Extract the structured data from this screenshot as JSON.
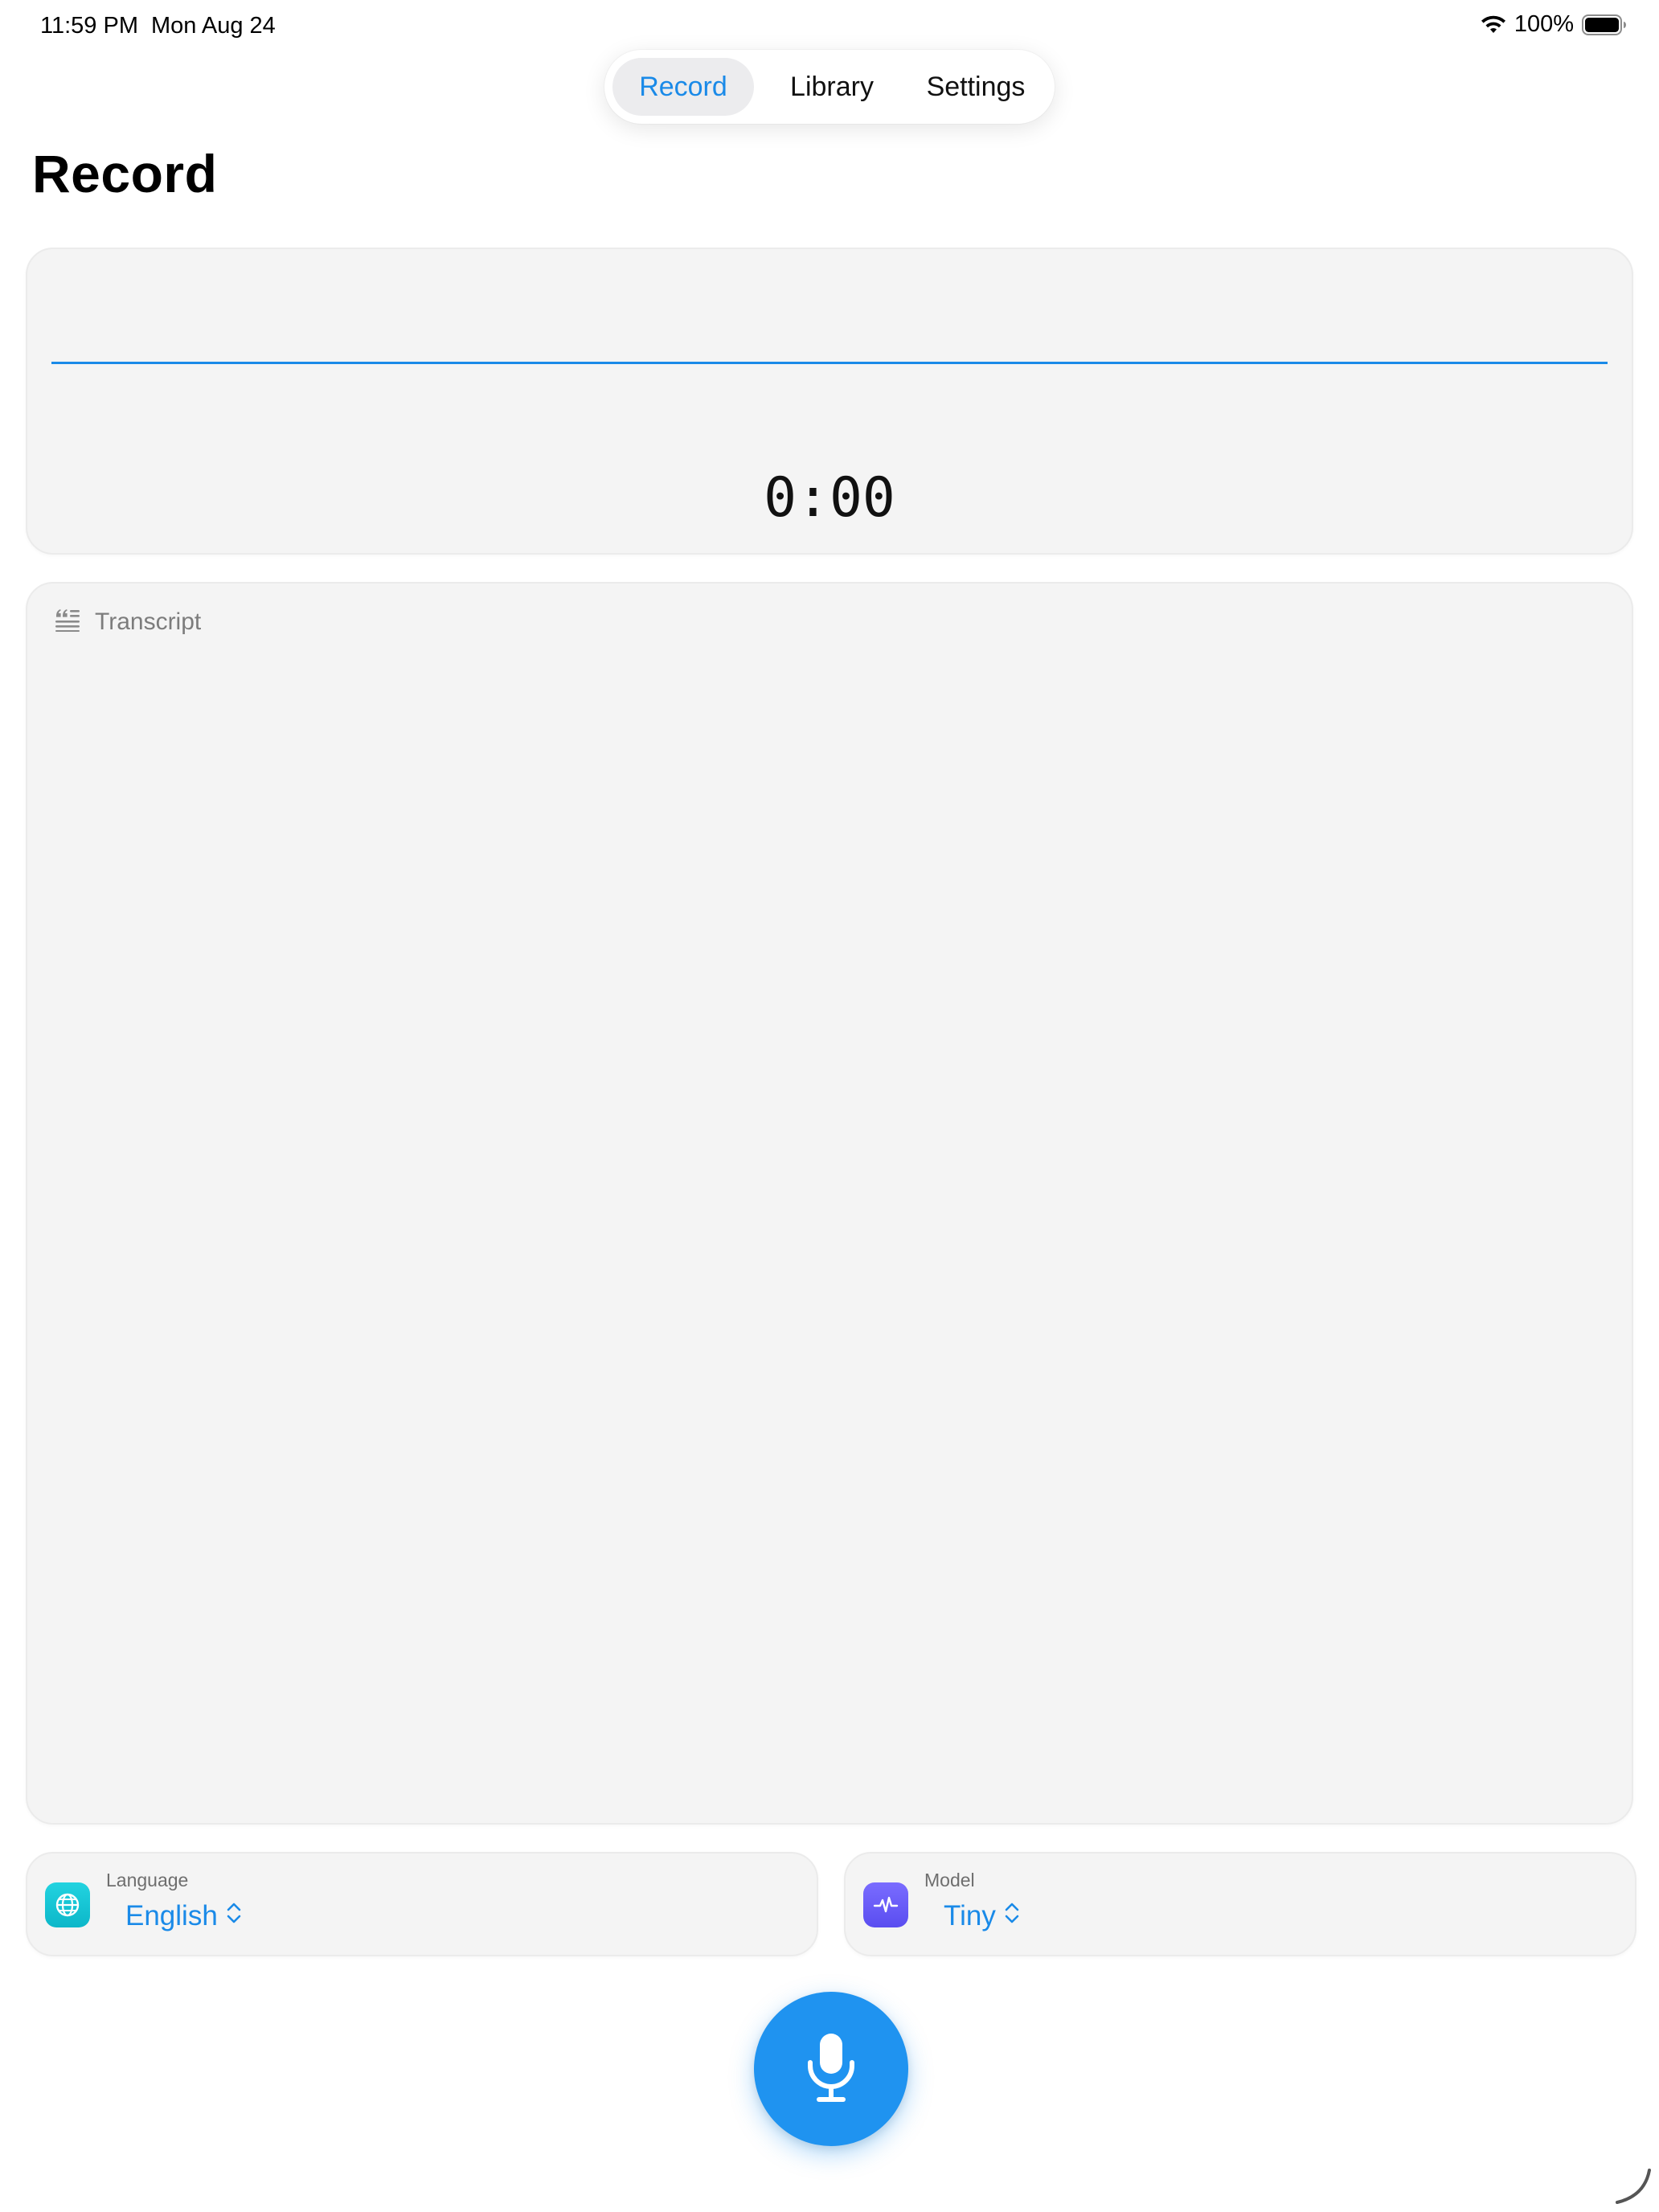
{
  "status_bar": {
    "time": "11:59 PM",
    "date": "Mon Aug 24",
    "battery": "100%"
  },
  "tabs": [
    {
      "label": "Record",
      "active": true
    },
    {
      "label": "Library",
      "active": false
    },
    {
      "label": "Settings",
      "active": false
    }
  ],
  "page": {
    "title": "Record"
  },
  "recorder": {
    "timer": "0:00",
    "waveform_color": "#1a8ae8"
  },
  "transcript": {
    "label": "Transcript",
    "icon": "quote-text-icon"
  },
  "language_picker": {
    "caption": "Language",
    "value": "English",
    "icon": "globe-icon"
  },
  "model_picker": {
    "caption": "Model",
    "value": "Tiny",
    "icon": "waveform-icon"
  },
  "mic_button": {
    "icon": "microphone-icon",
    "color": "#1f93f0"
  },
  "colors": {
    "accent": "#1a8ae8",
    "card_background": "#f4f4f4"
  }
}
